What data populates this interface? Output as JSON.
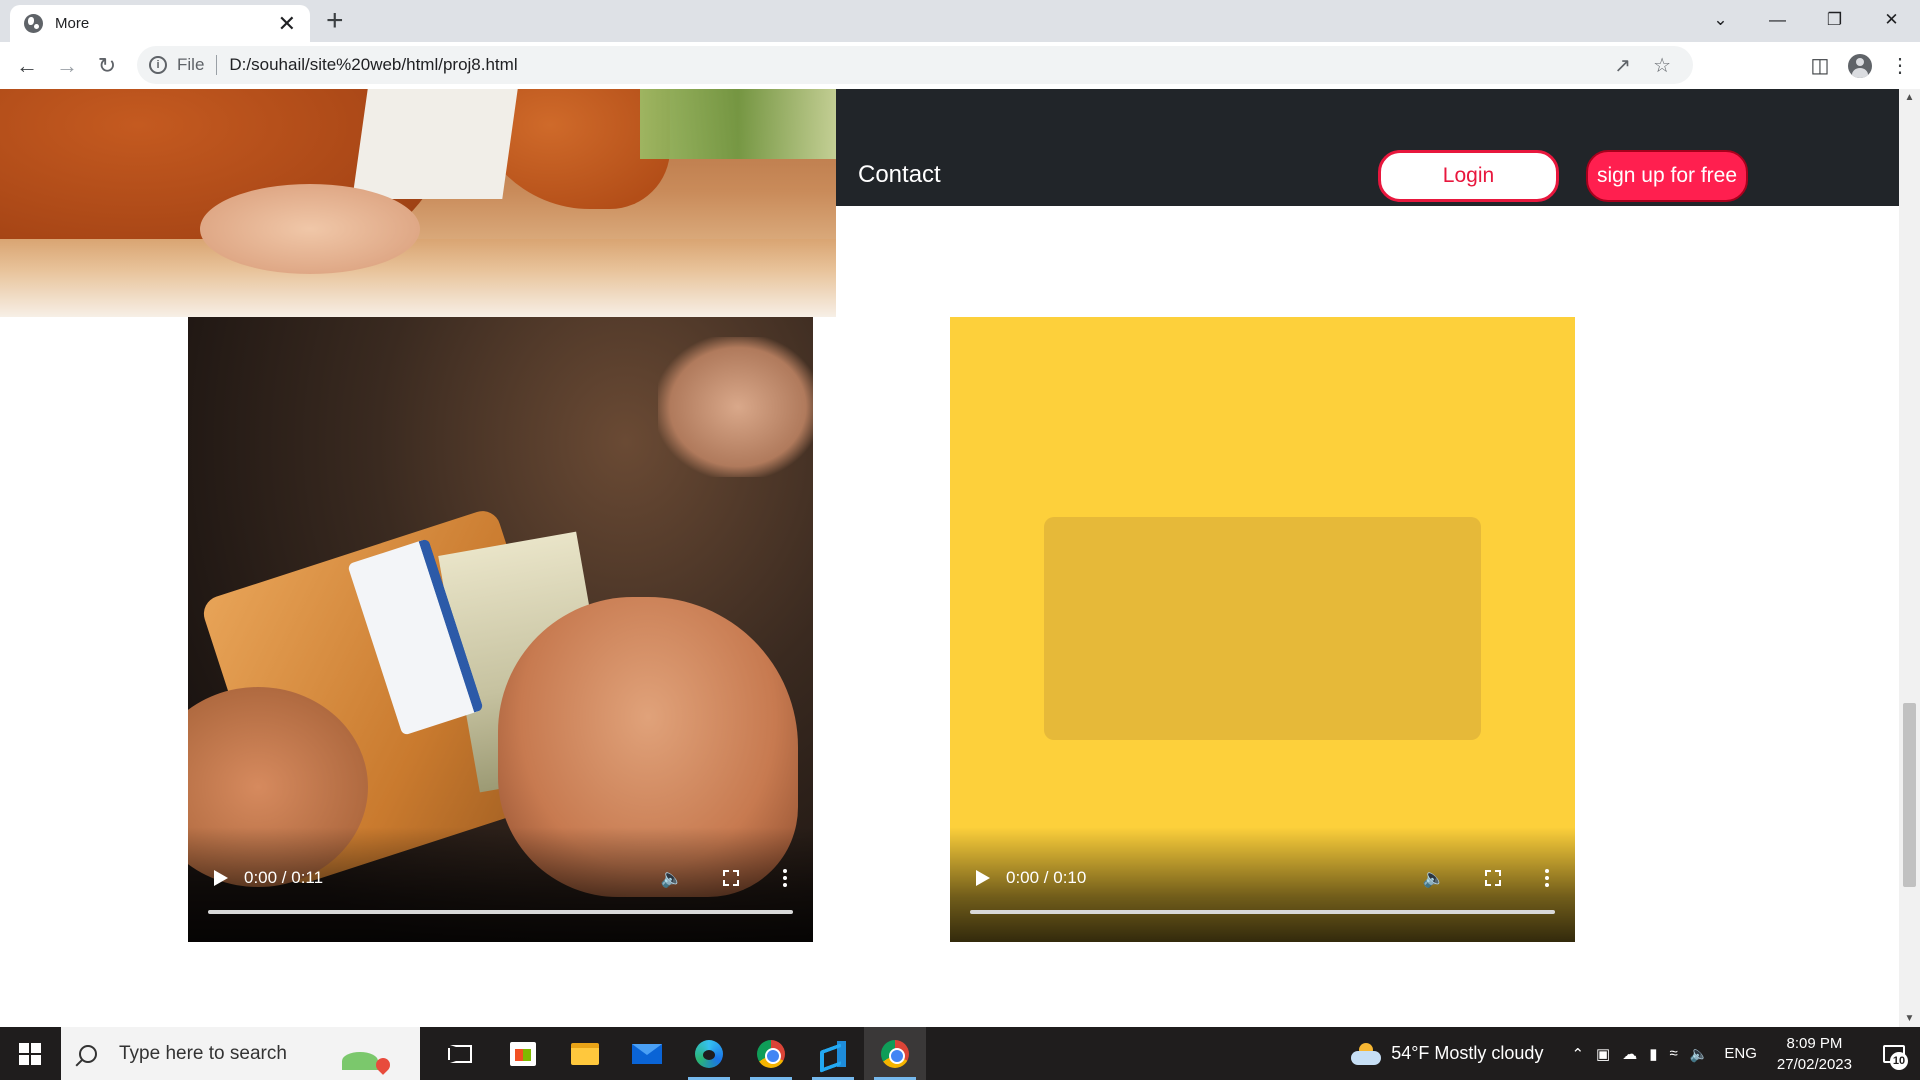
{
  "browser": {
    "tab_title": "More",
    "close_glyph": "✕",
    "new_tab_glyph": "+",
    "scheme": "File",
    "url": "D:/souhail/site%20web/html/proj8.html",
    "window_controls": [
      "⌄",
      "—",
      "❐",
      "✕"
    ],
    "icons": [
      "back-arrow-icon",
      "forward-arrow-icon",
      "reload-icon",
      "info-icon",
      "share-icon",
      "bookmark-star-icon",
      "side-panel-icon",
      "profile-icon",
      "kebab-menu-icon"
    ]
  },
  "nav": {
    "contact_label": "Contact",
    "login_label": "Login",
    "signup_label": "sign up for free",
    "colors": {
      "band": "#212529",
      "accent": "#ff1f4f",
      "login_border": "#e8173d"
    }
  },
  "videos": [
    {
      "time": "0:00 / 0:11",
      "progress": 0
    },
    {
      "time": "0:00 / 0:10",
      "progress": 0,
      "background": "#fdd03b"
    }
  ],
  "taskbar": {
    "search_placeholder": "Type here to search",
    "weather": "54°F  Mostly cloudy",
    "language": "ENG",
    "time": "8:09 PM",
    "date": "27/02/2023",
    "notification_count": "10",
    "apps": [
      "task-view",
      "microsoft-store",
      "file-explorer",
      "mail",
      "edge",
      "chrome",
      "vscode",
      "chrome-active"
    ]
  }
}
